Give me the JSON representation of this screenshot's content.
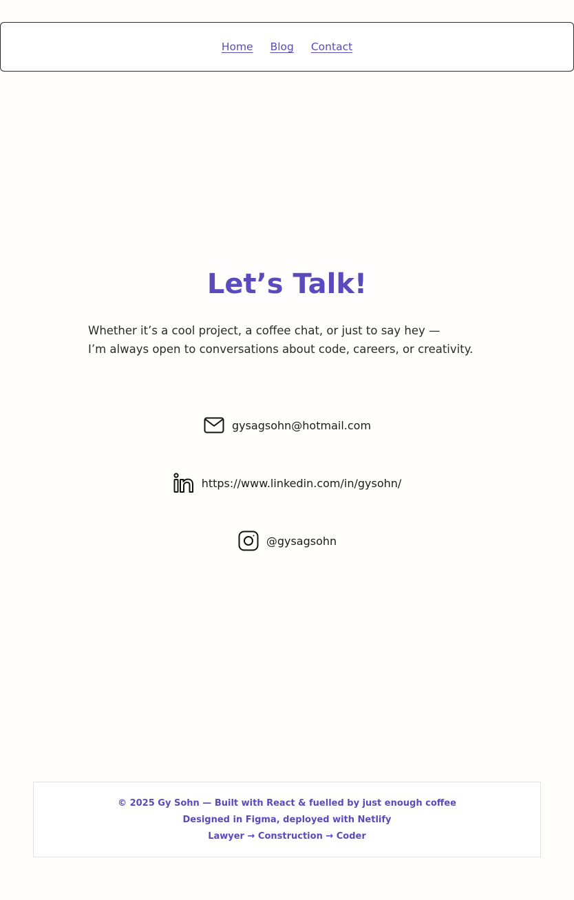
{
  "nav": {
    "items": [
      {
        "label": "Home"
      },
      {
        "label": "Blog"
      },
      {
        "label": "Contact"
      }
    ]
  },
  "main": {
    "title": "Let’s Talk!",
    "intro_line1": "Whether it’s a cool project, a coffee chat, or just to say hey —",
    "intro_line2": "I’m always open to conversations about code, careers, or creativity."
  },
  "contacts": {
    "email": {
      "icon": "mail-icon",
      "text": "gysagsohn@hotmail.com"
    },
    "linkedin": {
      "icon": "linkedin-icon",
      "text": "https://www.linkedin.com/in/gysohn/"
    },
    "instagram": {
      "icon": "instagram-icon",
      "text": "@gysagsohn"
    }
  },
  "footer": {
    "line1": "© 2025 Gy Sohn — Built with React & fuelled by just enough coffee",
    "line2": "Designed in Figma, deployed with Netlify",
    "line3": "Lawyer → Construction → Coder"
  },
  "colors": {
    "accent": "#5a4bbd",
    "background": "#fffefc",
    "text": "#222222"
  }
}
